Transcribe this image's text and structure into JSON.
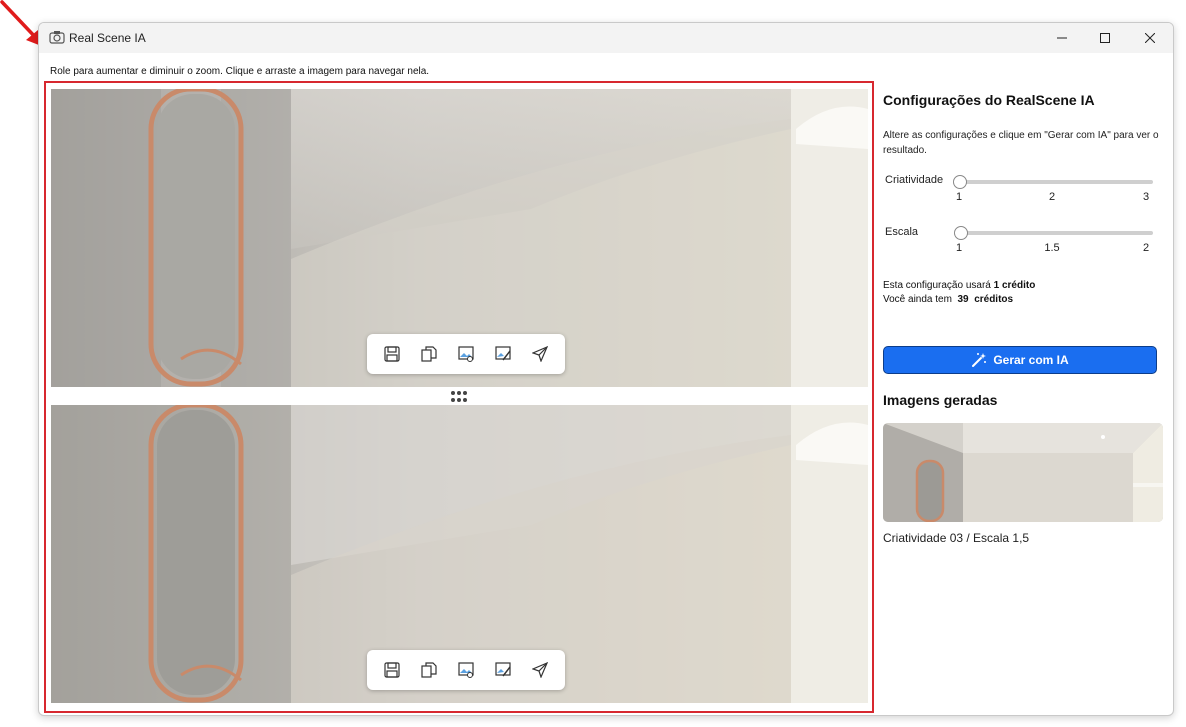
{
  "window": {
    "title": "Real Scene IA",
    "hint": "Role para aumentar e diminuir o zoom. Clique e arraste a imagem para navegar nela."
  },
  "toolbar_icons": [
    "save-icon",
    "copy-icon",
    "image-edit-icon",
    "annotate-icon",
    "send-icon"
  ],
  "settings": {
    "title": "Configurações do RealScene IA",
    "description": "Altere as configurações e clique em \"Gerar com IA\" para ver o resultado.",
    "criatividade": {
      "label": "Criatividade",
      "ticks": [
        "1",
        "2",
        "3"
      ],
      "value": 1
    },
    "escala": {
      "label": "Escala",
      "ticks": [
        "1",
        "1.5",
        "2"
      ],
      "value": 1
    },
    "credits_line1_prefix": "Esta configuração usará",
    "credits_line1_value": "1 crédito",
    "credits_line2_prefix": "Você ainda tem",
    "credits_line2_count": "39",
    "credits_line2_unit": "créditos",
    "generate_label": "Gerar com IA",
    "generated_title": "Imagens geradas",
    "generated_caption": "Criatividade 03 / Escala 1,5"
  },
  "colors": {
    "accent": "#1a6ef0",
    "frame": "#d7282f",
    "annotation_arrow": "#e01b1b"
  }
}
